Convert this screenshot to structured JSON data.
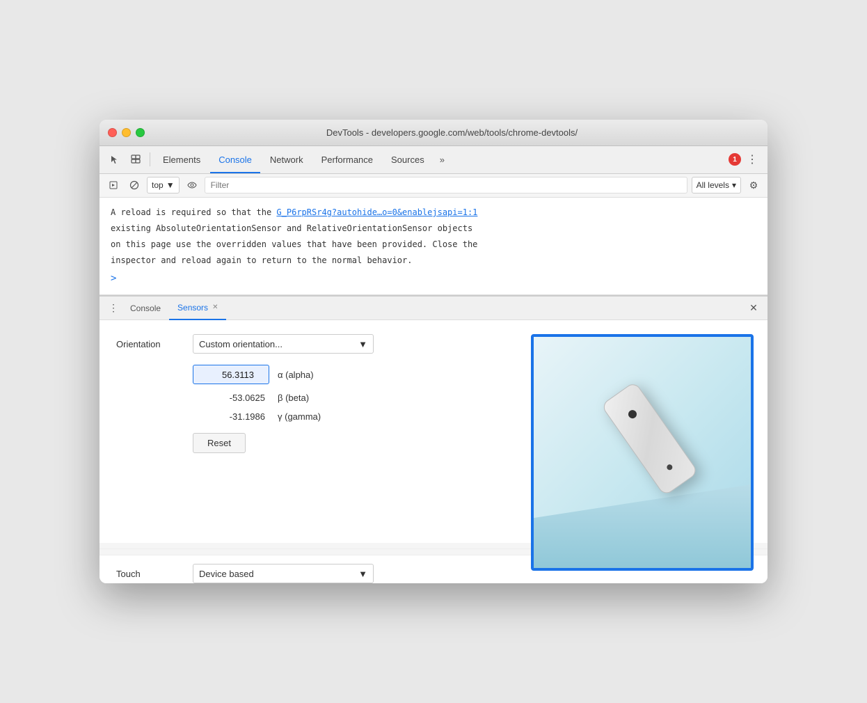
{
  "window": {
    "title": "DevTools - developers.google.com/web/tools/chrome-devtools/"
  },
  "titlebar": {
    "traffic_lights": [
      "red",
      "yellow",
      "green"
    ]
  },
  "toolbar": {
    "tabs": [
      {
        "label": "Elements",
        "active": false
      },
      {
        "label": "Console",
        "active": true
      },
      {
        "label": "Network",
        "active": false
      },
      {
        "label": "Performance",
        "active": false
      },
      {
        "label": "Sources",
        "active": false
      }
    ],
    "more_label": "»",
    "error_count": "1",
    "menu_icon": "⋮"
  },
  "console_toolbar": {
    "run_icon": "▶",
    "block_icon": "🚫",
    "context_label": "top",
    "dropdown_arrow": "▼",
    "eye_icon": "👁",
    "filter_placeholder": "Filter",
    "levels_label": "All levels",
    "gear_icon": "⚙"
  },
  "console_output": {
    "message_line1": "A reload is required so that the ",
    "message_link": "G_P6rpRSr4g?autohide…o=0&enablejsapi=1:1",
    "message_line2": "existing AbsoluteOrientationSensor and RelativeOrientationSensor objects",
    "message_line3": "on this page use the overridden values that have been provided. Close the",
    "message_line4": "inspector and reload again to return to the normal behavior."
  },
  "bottom_panel": {
    "tabs": [
      {
        "label": "Console",
        "active": false,
        "closeable": false
      },
      {
        "label": "Sensors",
        "active": true,
        "closeable": true
      }
    ],
    "close_icon": "✕"
  },
  "sensors": {
    "orientation_label": "Orientation",
    "dropdown_value": "Custom orientation...",
    "dropdown_arrow": "▼",
    "alpha_value": "56.3113",
    "alpha_label": "α (alpha)",
    "beta_value": "-53.0625",
    "beta_label": "β (beta)",
    "gamma_value": "-31.1986",
    "gamma_label": "γ (gamma)",
    "reset_label": "Reset",
    "touch_label": "Touch",
    "touch_dropdown": "Device based",
    "touch_arrow": "▼"
  }
}
